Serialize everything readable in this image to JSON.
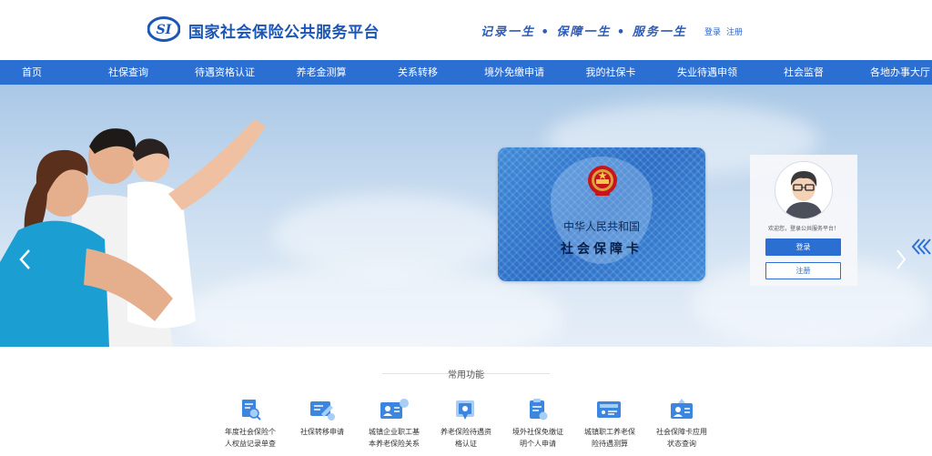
{
  "header": {
    "site_title": "国家社会保险公共服务平台",
    "logo_text": "SI",
    "slogan": "记录一生 • 保障一生 • 服务一生",
    "login_link": "登录",
    "register_link": "注册"
  },
  "nav": {
    "items": [
      {
        "label": "首页"
      },
      {
        "label": "社保查询"
      },
      {
        "label": "待遇资格认证"
      },
      {
        "label": "养老金测算"
      },
      {
        "label": "关系转移"
      },
      {
        "label": "境外免缴申请"
      },
      {
        "label": "我的社保卡"
      },
      {
        "label": "失业待遇申领"
      },
      {
        "label": "社会监督"
      },
      {
        "label": "各地办事大厅"
      }
    ]
  },
  "banner": {
    "card_line1": "中华人民共和国",
    "card_line2": "社会保障卡",
    "welcome_text": "欢迎您，登录公共服务平台！",
    "login_button": "登录",
    "register_button": "注册"
  },
  "common_functions": {
    "title": "常用功能",
    "items": [
      {
        "icon": "document-search-icon",
        "line1": "年度社会保险个",
        "line2": "人权益记录单查"
      },
      {
        "icon": "transfer-edit-icon",
        "line1": "社保转移申请",
        "line2": ""
      },
      {
        "icon": "pension-id-card-icon",
        "line1": "城镇企业职工基",
        "line2": "本养老保险关系"
      },
      {
        "icon": "certificate-icon",
        "line1": "养老保险待遇资",
        "line2": "格认证"
      },
      {
        "icon": "clipboard-icon",
        "line1": "境外社保免缴证",
        "line2": "明个人申请"
      },
      {
        "icon": "calculator-icon",
        "line1": "城镇职工养老保",
        "line2": "险待遇测算"
      },
      {
        "icon": "card-application-icon",
        "line1": "社会保障卡应用",
        "line2": "状态查询"
      }
    ]
  },
  "colors": {
    "brand_blue": "#2c6fd3",
    "title_blue": "#1b55b5"
  }
}
